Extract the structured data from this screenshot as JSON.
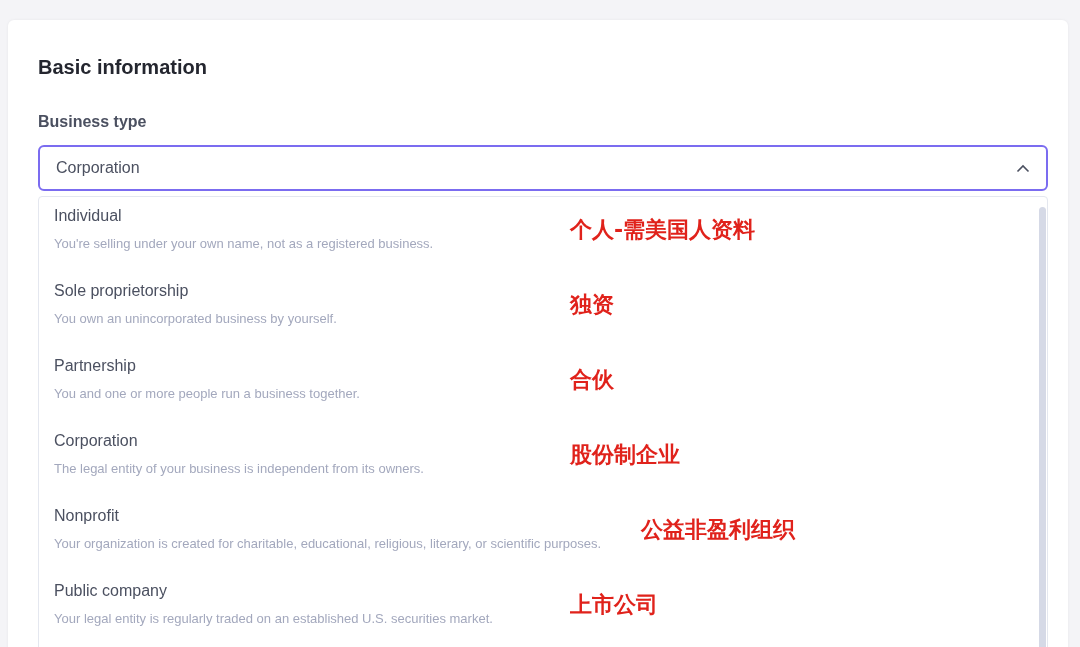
{
  "section_title": "Basic information",
  "field": {
    "label": "Business type",
    "value": "Corporation",
    "expanded": true
  },
  "options": [
    {
      "title": "Individual",
      "description": "You're selling under your own name, not as a registered business.",
      "annotation": "个人-需美国人资料"
    },
    {
      "title": "Sole proprietorship",
      "description": "You own an unincorporated business by yourself.",
      "annotation": "独资"
    },
    {
      "title": "Partnership",
      "description": "You and one or more people run a business together.",
      "annotation": "合伙"
    },
    {
      "title": "Corporation",
      "description": "The legal entity of your business is independent from its owners.",
      "annotation": "股份制企业"
    },
    {
      "title": "Nonprofit",
      "description": "Your organization is created for charitable, educational, religious, literary, or scientific purposes.",
      "annotation": "公益非盈利组织"
    },
    {
      "title": "Public company",
      "description": "Your legal entity is regularly traded on an established U.S. securities market.",
      "annotation": "上市公司"
    }
  ]
}
